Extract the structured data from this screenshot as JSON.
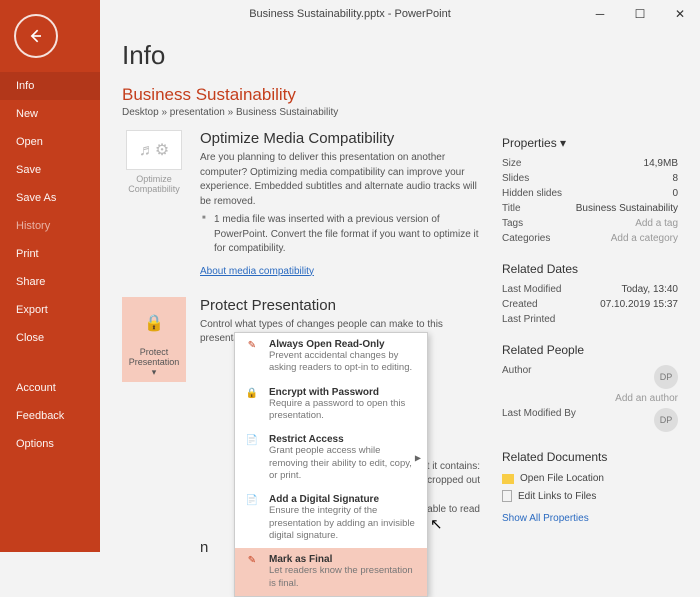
{
  "window": {
    "title": "Business Sustainability.pptx - PowerPoint"
  },
  "sidebar": {
    "items": [
      {
        "label": "Info",
        "active": true
      },
      {
        "label": "New"
      },
      {
        "label": "Open"
      },
      {
        "label": "Save"
      },
      {
        "label": "Save As"
      },
      {
        "label": "History",
        "dim": true
      },
      {
        "label": "Print"
      },
      {
        "label": "Share"
      },
      {
        "label": "Export"
      },
      {
        "label": "Close"
      }
    ],
    "bottom": [
      {
        "label": "Account"
      },
      {
        "label": "Feedback"
      },
      {
        "label": "Options"
      }
    ]
  },
  "page": {
    "title": "Info",
    "doc_title": "Business Sustainability",
    "breadcrumb": "Desktop » presentation » Business Sustainability"
  },
  "optimize": {
    "btn": "Optimize Compatibility",
    "title": "Optimize Media Compatibility",
    "desc": "Are you planning to deliver this presentation on another computer? Optimizing media compatibility can improve your experience. Embedded subtitles and alternate audio tracks will be removed.",
    "sub": "1 media file was inserted with a previous version of PowerPoint. Convert the file format if you want to optimize it for compatibility.",
    "link": "About media compatibility"
  },
  "protect": {
    "btn": "Protect Presentation ▾",
    "title": "Protect Presentation",
    "desc": "Control what types of changes people can make to this presentation."
  },
  "obscured": {
    "l1": "ware that it contains:",
    "l2": "or's name and cropped out",
    "l3": "isabilities are unable to read",
    "l4": "n"
  },
  "dropdown": [
    {
      "title": "Always Open Read-Only",
      "desc": "Prevent accidental changes by asking readers to opt-in to editing.",
      "icon": "pencil"
    },
    {
      "title": "Encrypt with Password",
      "desc": "Require a password to open this presentation.",
      "icon": "lock"
    },
    {
      "title": "Restrict Access",
      "desc": "Grant people access while removing their ability to edit, copy, or print.",
      "icon": "restrict",
      "submenu": true
    },
    {
      "title": "Add a Digital Signature",
      "desc": "Ensure the integrity of the presentation by adding an invisible digital signature.",
      "icon": "sign"
    },
    {
      "title": "Mark as Final",
      "desc": "Let readers know the presentation is final.",
      "icon": "final"
    }
  ],
  "properties": {
    "heading": "Properties ▾",
    "rows": [
      {
        "k": "Size",
        "v": "14,9MB"
      },
      {
        "k": "Slides",
        "v": "8"
      },
      {
        "k": "Hidden slides",
        "v": "0"
      },
      {
        "k": "Title",
        "v": "Business Sustainability"
      },
      {
        "k": "Tags",
        "v": "Add a tag",
        "ph": true
      },
      {
        "k": "Categories",
        "v": "Add a category",
        "ph": true
      }
    ]
  },
  "dates": {
    "heading": "Related Dates",
    "rows": [
      {
        "k": "Last Modified",
        "v": "Today, 13:40"
      },
      {
        "k": "Created",
        "v": "07.10.2019 15:37"
      },
      {
        "k": "Last Printed",
        "v": ""
      }
    ]
  },
  "people": {
    "heading": "Related People",
    "author_label": "Author",
    "author_initials": "DP",
    "add_author": "Add an author",
    "modified_label": "Last Modified By",
    "modified_initials": "DP"
  },
  "docs": {
    "heading": "Related Documents",
    "open": "Open File Location",
    "edit": "Edit Links to Files",
    "showall": "Show All Properties"
  }
}
